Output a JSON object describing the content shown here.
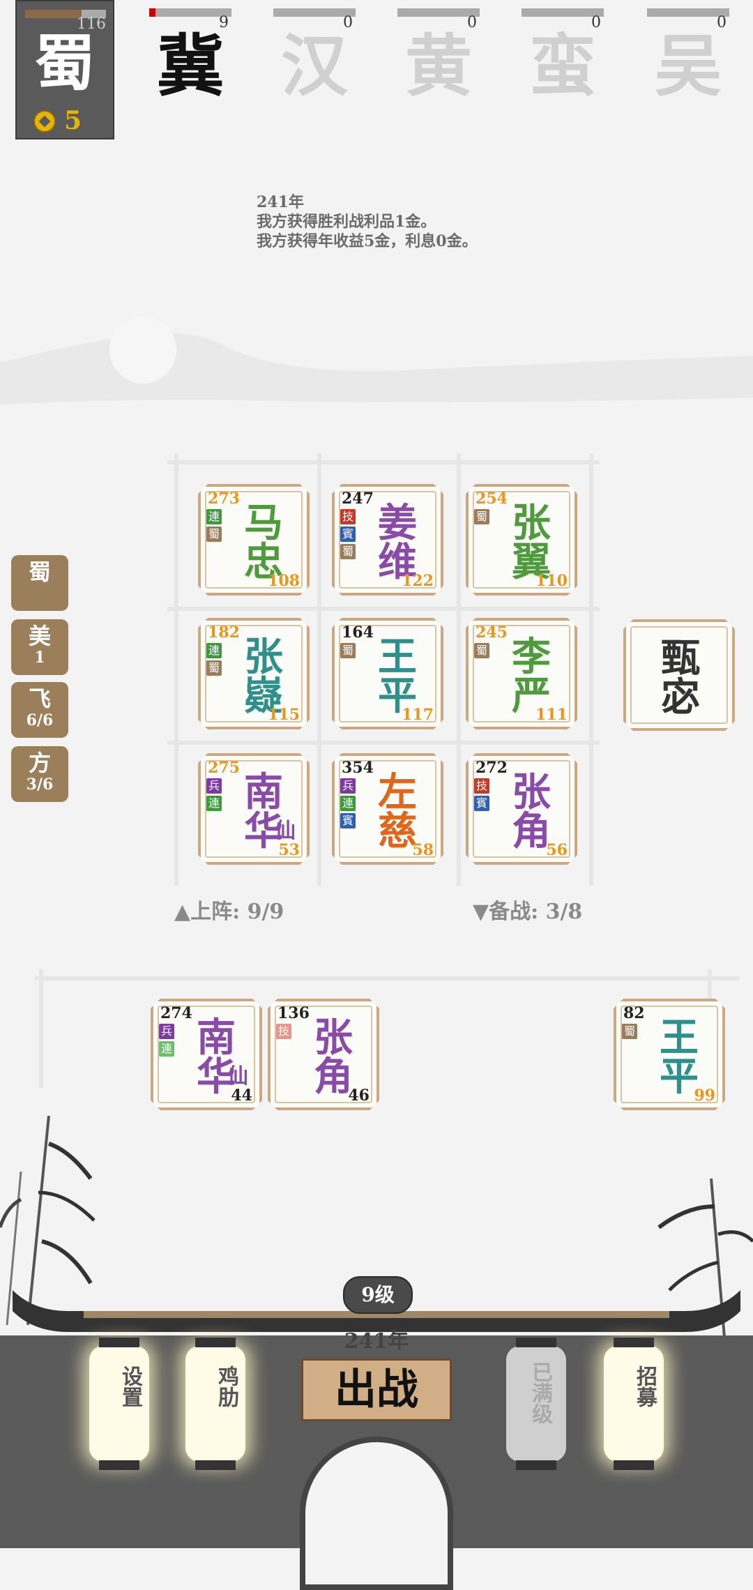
{
  "player": {
    "name": "蜀",
    "hp": "116",
    "hp_fraction": 0.7,
    "gold": "5"
  },
  "enemies": [
    {
      "name": "冀",
      "count": "9",
      "progress": 0.08,
      "active": true
    },
    {
      "name": "汉",
      "count": "0",
      "progress": 0,
      "active": false
    },
    {
      "name": "黄",
      "count": "0",
      "progress": 0,
      "active": false
    },
    {
      "name": "蛮",
      "count": "0",
      "progress": 0,
      "active": false
    },
    {
      "name": "吴",
      "count": "0",
      "progress": 0,
      "active": false
    }
  ],
  "log": {
    "year": "241年",
    "line1": "我方获得胜利战利品1金。",
    "line2": "我方获得年收益5金，利息0金。"
  },
  "side_buttons": [
    {
      "a": "蜀",
      "b": ""
    },
    {
      "a": "美",
      "b": "1"
    },
    {
      "a": "飞",
      "b": "6/6"
    },
    {
      "a": "方",
      "b": "3/6"
    }
  ],
  "board": [
    {
      "n1": "马",
      "n2": "忠",
      "hp": "273",
      "lvl": "108",
      "color": "#4f9a3c",
      "hp_color": "#e8971c",
      "tags": [
        [
          "連",
          "green"
        ],
        [
          "蜀",
          "brown"
        ]
      ]
    },
    {
      "n1": "姜",
      "n2": "维",
      "hp": "247",
      "lvl": "122",
      "color": "#8a4aa8",
      "hp_color": "#222",
      "tags": [
        [
          "技",
          "red"
        ],
        [
          "賓",
          "blue"
        ],
        [
          "蜀",
          "brown"
        ]
      ]
    },
    {
      "n1": "张",
      "n2": "翼",
      "hp": "254",
      "lvl": "110",
      "color": "#4f9a3c",
      "hp_color": "#e8971c",
      "tags": [
        [
          "蜀",
          "brown"
        ]
      ]
    },
    {
      "n1": "张",
      "n2": "嶷",
      "hp": "182",
      "lvl": "115",
      "color": "#2f8f8a",
      "hp_color": "#e8971c",
      "tags": [
        [
          "連",
          "green"
        ],
        [
          "蜀",
          "brown"
        ]
      ]
    },
    {
      "n1": "王",
      "n2": "平",
      "hp": "164",
      "lvl": "117",
      "color": "#2f8f8a",
      "hp_color": "#222",
      "tags": [
        [
          "蜀",
          "brown"
        ]
      ]
    },
    {
      "n1": "李",
      "n2": "严",
      "hp": "245",
      "lvl": "111",
      "color": "#4f9a3c",
      "hp_color": "#e8971c",
      "tags": [
        [
          "蜀",
          "brown"
        ]
      ]
    },
    {
      "n1": "南",
      "n2": "华",
      "hp": "275",
      "lvl": "53",
      "color": "#8a4aa8",
      "hp_color": "#e8971c",
      "extra": "仙",
      "tags": [
        [
          "兵",
          "purple"
        ],
        [
          "連",
          "green"
        ]
      ]
    },
    {
      "n1": "左",
      "n2": "慈",
      "hp": "354",
      "lvl": "58",
      "color": "#e0661c",
      "hp_color": "#222",
      "tags": [
        [
          "兵",
          "purple"
        ],
        [
          "連",
          "green"
        ],
        [
          "賓",
          "blue"
        ]
      ]
    },
    {
      "n1": "张",
      "n2": "角",
      "hp": "272",
      "lvl": "56",
      "color": "#8a4aa8",
      "hp_color": "#222",
      "tags": [
        [
          "技",
          "red"
        ],
        [
          "賓",
          "blue"
        ]
      ]
    }
  ],
  "recruit": {
    "n1": "甄",
    "n2": "宓",
    "color": "#8a6a44"
  },
  "deploy_label": "▲上阵: 9/9",
  "reserve_label": "▼备战: 3/8",
  "reserve": [
    {
      "n1": "南",
      "n2": "华",
      "hp": "274",
      "lvl": "44",
      "color": "#8a4aa8",
      "hp_color": "#222",
      "lvl_color": "#222",
      "extra": "仙",
      "tags": [
        [
          "兵",
          "purple"
        ],
        [
          "連",
          "lgreen"
        ]
      ]
    },
    {
      "n1": "张",
      "n2": "角",
      "hp": "136",
      "lvl": "46",
      "color": "#8a4aa8",
      "hp_color": "#222",
      "lvl_color": "#222",
      "tags": [
        [
          "技",
          "pink"
        ]
      ]
    },
    {
      "n1": "王",
      "n2": "平",
      "hp": "82",
      "lvl": "99",
      "color": "#2f8f8a",
      "hp_color": "#222",
      "lvl_color": "#e8971c",
      "tags": [
        [
          "蜀",
          "brown"
        ]
      ]
    }
  ],
  "bottom": {
    "level": "9级",
    "year": "241年",
    "settings": "设置",
    "helper": "鸡肋",
    "maxed": "已满级",
    "recruit": "招募",
    "battle": "出战"
  }
}
